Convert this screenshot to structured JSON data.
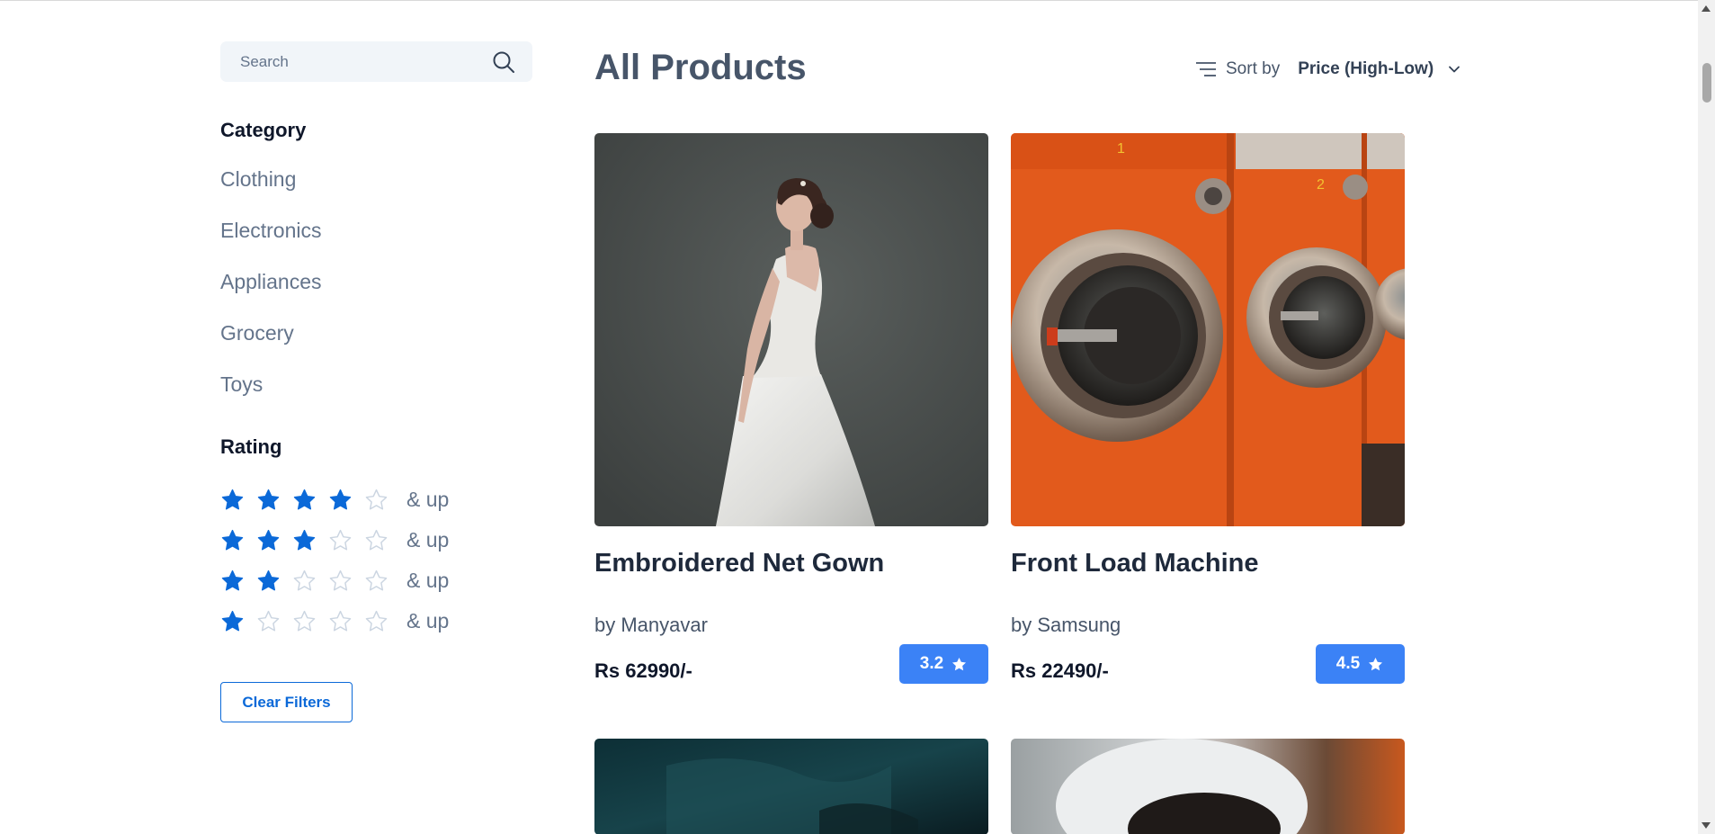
{
  "colors": {
    "accent": "#0b69d8",
    "badge": "#3b82f6",
    "star_filled": "#0b69d8",
    "star_empty": "#cbd5e1"
  },
  "sidebar": {
    "search": {
      "placeholder": "Search",
      "value": "",
      "icon": "search-icon"
    },
    "category_heading": "Category",
    "categories": [
      {
        "label": "Clothing"
      },
      {
        "label": "Electronics"
      },
      {
        "label": "Appliances"
      },
      {
        "label": "Grocery"
      },
      {
        "label": "Toys"
      }
    ],
    "rating_heading": "Rating",
    "ratings": [
      {
        "stars": 4,
        "label": "& up"
      },
      {
        "stars": 3,
        "label": "& up"
      },
      {
        "stars": 2,
        "label": "& up"
      },
      {
        "stars": 1,
        "label": "& up"
      }
    ],
    "clear_filters_label": "Clear Filters"
  },
  "main": {
    "title": "All Products",
    "sort": {
      "label": "Sort by",
      "selected": "Price (High-Low)",
      "icon": "sort-lines-icon"
    },
    "products": [
      {
        "name": "Embroidered Net Gown",
        "brand": "by Manyavar",
        "price": "Rs 62990/-",
        "rating": "3.2",
        "image": "bridal-gown-photo"
      },
      {
        "name": "Front Load Machine",
        "brand": "by Samsung",
        "price": "Rs 22490/-",
        "rating": "4.5",
        "image": "orange-washing-machines-photo"
      },
      {
        "name": "",
        "brand": "",
        "price": "",
        "rating": "",
        "image": "dark-teal-product-photo"
      },
      {
        "name": "",
        "brand": "",
        "price": "",
        "rating": "",
        "image": "white-orange-product-photo"
      }
    ]
  }
}
